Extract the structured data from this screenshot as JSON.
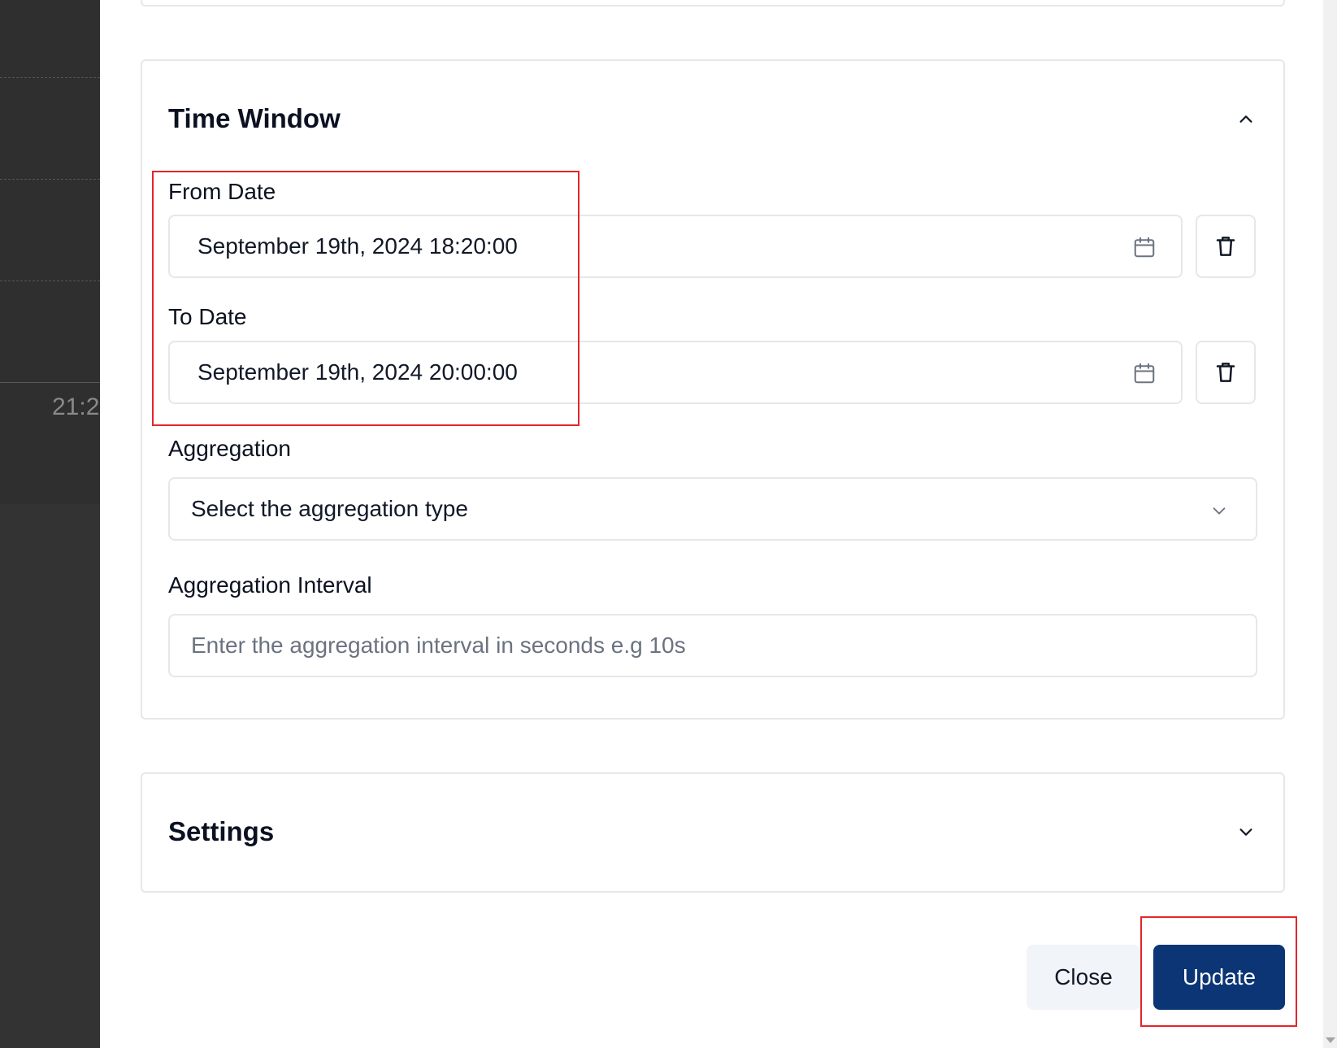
{
  "background": {
    "axis_tick_partial": "21:2"
  },
  "time_window": {
    "title": "Time Window",
    "expanded": true,
    "from_date": {
      "label": "From Date",
      "value": "September 19th, 2024 18:20:00"
    },
    "to_date": {
      "label": "To Date",
      "value": "September 19th, 2024 20:00:00"
    },
    "aggregation": {
      "label": "Aggregation",
      "selected": "Select the aggregation type"
    },
    "aggregation_interval": {
      "label": "Aggregation Interval",
      "placeholder": "Enter the aggregation interval in seconds e.g 10s",
      "value": ""
    }
  },
  "settings": {
    "title": "Settings",
    "expanded": false
  },
  "footer": {
    "close_label": "Close",
    "update_label": "Update"
  },
  "colors": {
    "primary": "#0b3574",
    "highlight": "#e3262b",
    "border": "#e5e7eb",
    "backdrop": "#333333"
  },
  "icons": [
    "calendar-icon",
    "trash-icon",
    "chevron-up-icon",
    "chevron-down-icon"
  ]
}
